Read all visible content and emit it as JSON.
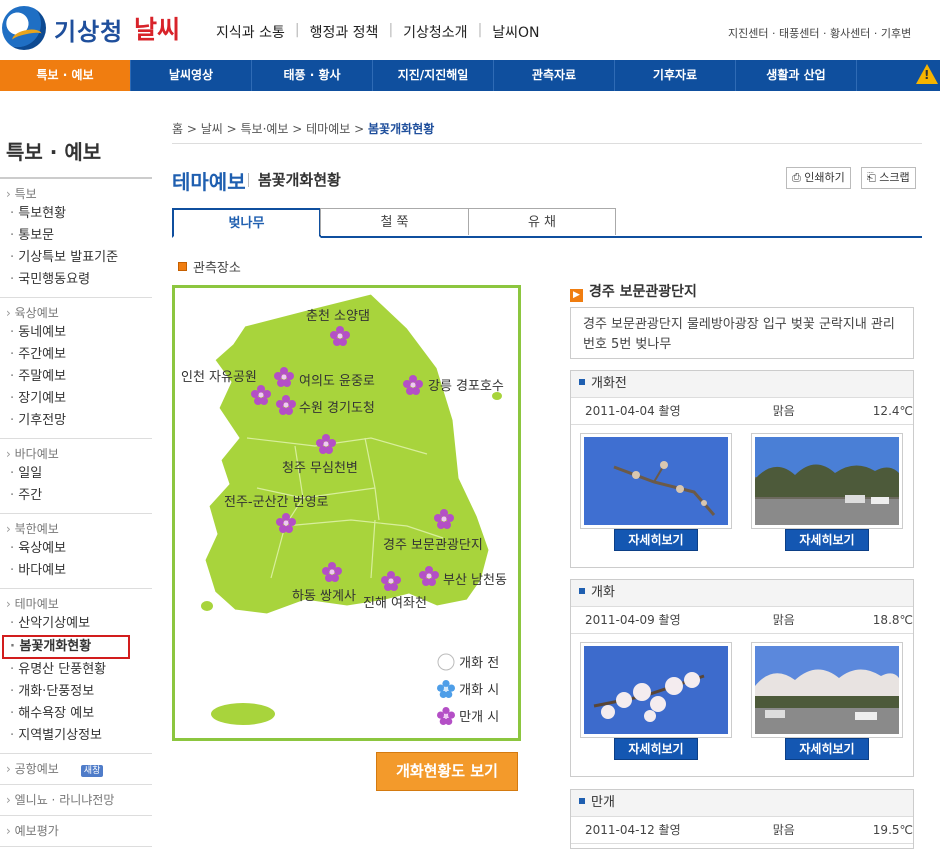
{
  "header": {
    "logo_text": "기상청",
    "logo_sub": "날씨",
    "top_menu": [
      "지식과 소통",
      "행정과 정책",
      "기상청소개",
      "날씨ON"
    ],
    "top_links": "지진센터 · 태풍센터 · 황사센터 · 기후변"
  },
  "nav": {
    "items": [
      "특보 · 예보",
      "날씨영상",
      "태풍 · 황사",
      "지진/지진해일",
      "관측자료",
      "기후자료",
      "생활과 산업"
    ]
  },
  "sidebar": {
    "title": "특보 · 예보",
    "sections": [
      {
        "head": "특보",
        "items": [
          "특보현황",
          "통보문",
          "기상특보 발표기준",
          "국민행동요령"
        ]
      },
      {
        "head": "육상예보",
        "items": [
          "동네예보",
          "주간예보",
          "주말예보",
          "장기예보",
          "기후전망"
        ]
      },
      {
        "head": "바다예보",
        "items": [
          "일일",
          "주간"
        ]
      },
      {
        "head": "북한예보",
        "items": [
          "육상예보",
          "바다예보"
        ]
      },
      {
        "head": "테마예보",
        "items": [
          "산악기상예보",
          "봄꽃개화현황",
          "유명산 단풍현황",
          "개화·단풍정보",
          "해수욕장 예보",
          "지역별기상정보"
        ]
      },
      {
        "head": "공항예보",
        "items": [],
        "badge": "새창"
      },
      {
        "head": "엘니뇨 · 라니냐전망",
        "items": []
      },
      {
        "head": "예보평가",
        "items": []
      }
    ]
  },
  "breadcrumb": {
    "path": "홈 > 날씨 > 특보·예보 > 테마예보 > ",
    "current": "봄꽃개화현황"
  },
  "page": {
    "title": "테마예보",
    "subtitle": "봄꽃개화현황",
    "print_label": "인쇄하기",
    "scrap_label": "스크랩"
  },
  "tabs": [
    "벚나무",
    "철 쭉",
    "유 채"
  ],
  "map": {
    "section_label": "관측장소",
    "places": [
      "춘천 소양댐",
      "인천 자유공원",
      "여의도 윤중로",
      "강릉 경포호수",
      "수원 경기도청",
      "청주 무심천변",
      "전주-군산간 번영로",
      "경주 보문관광단지",
      "하동 쌍계사",
      "진해 여좌천",
      "부산 남천동"
    ],
    "legend": [
      "개화 전",
      "개화 시",
      "만개 시"
    ],
    "button": "개화현황도 보기"
  },
  "detail": {
    "location": "경주 보문관광단지",
    "description": "경주 보문관광단지 물레방아광장 입구 벚꽃 군락지내 관리번호 5번 벚나무",
    "stages": [
      {
        "name": "개화전",
        "date": "2011-04-04 촬영",
        "weather": "맑음",
        "temp": "12.4℃",
        "button": "자세히보기"
      },
      {
        "name": "개화",
        "date": "2011-04-09 촬영",
        "weather": "맑음",
        "temp": "18.8℃",
        "button": "자세히보기"
      },
      {
        "name": "만개",
        "date": "2011-04-12 촬영",
        "weather": "맑음",
        "temp": "19.5℃"
      }
    ]
  },
  "colors": {
    "nav_blue": "#0f4f9e",
    "active_orange": "#f07d10",
    "map_green": "#a8d43c",
    "bloom_purple": "#b44fc6",
    "bloom_blue": "#4e9ee8"
  }
}
